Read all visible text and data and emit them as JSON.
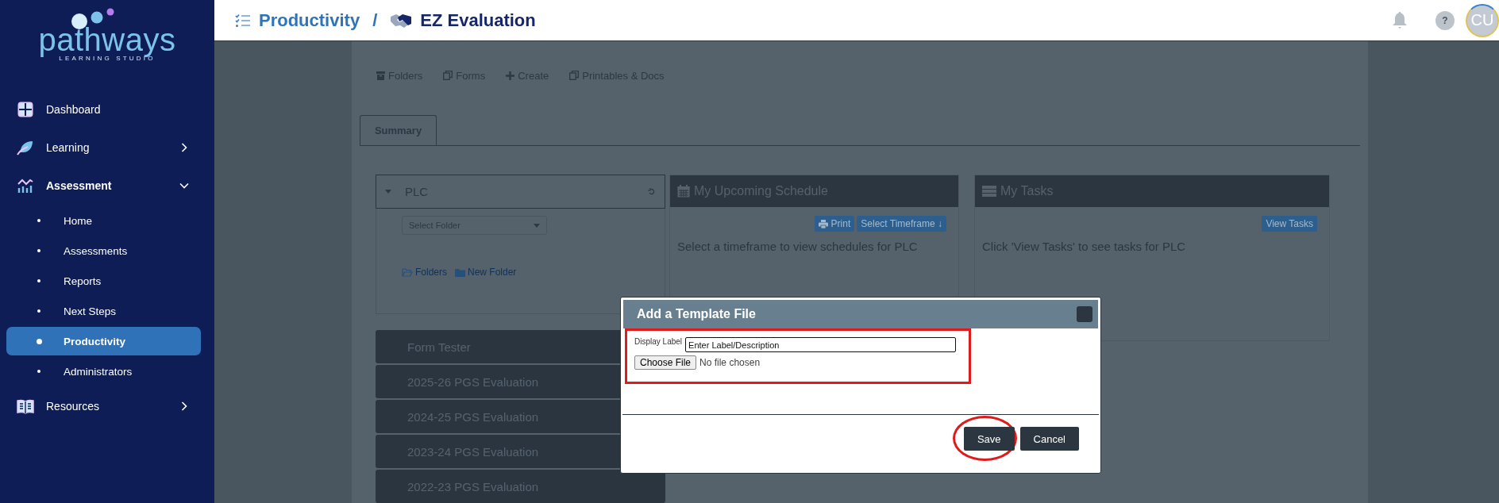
{
  "sidebar": {
    "logo": {
      "wordmark": "pathways",
      "tagline": "LEARNING STUDIO"
    },
    "items": [
      {
        "label": "Dashboard",
        "kind": "link"
      },
      {
        "label": "Learning",
        "kind": "group",
        "expanded": false
      },
      {
        "label": "Assessment",
        "kind": "group",
        "expanded": true,
        "children": [
          {
            "label": "Home",
            "selected": false
          },
          {
            "label": "Assessments",
            "selected": false
          },
          {
            "label": "Reports",
            "selected": false
          },
          {
            "label": "Next Steps",
            "selected": false
          },
          {
            "label": "Productivity",
            "selected": true
          },
          {
            "label": "Administrators",
            "selected": false
          }
        ]
      },
      {
        "label": "Resources",
        "kind": "group",
        "expanded": false
      }
    ]
  },
  "header": {
    "breadcrumb": [
      {
        "label": "Productivity",
        "kind": "section"
      },
      {
        "label": "EZ Evaluation",
        "kind": "page"
      }
    ],
    "separator": "/",
    "help": "?",
    "avatar": "CU"
  },
  "toolbar": [
    "Folders",
    "Forms",
    "Create",
    "Printables & Docs"
  ],
  "tabs": [
    {
      "label": "Summary",
      "selected": true
    }
  ],
  "folder_panel": {
    "title": "PLC",
    "select_placeholder": "Select Folder",
    "links": [
      "Folders",
      "New Folder"
    ]
  },
  "schedule_panel": {
    "title": "My Upcoming Schedule",
    "buttons": [
      {
        "label": "Print"
      },
      {
        "label": "Select Timeframe ↓"
      }
    ],
    "message": "Select a timeframe to view schedules for PLC"
  },
  "tasks_panel": {
    "title": "My Tasks",
    "buttons": [
      {
        "label": "View Tasks"
      }
    ],
    "message": "Click 'View Tasks' to see tasks for PLC"
  },
  "forms": [
    "Form Tester",
    "2025-26 PGS Evaluation",
    "2024-25 PGS Evaluation",
    "2023-24 PGS Evaluation",
    "2022-23 PGS Evaluation"
  ],
  "modal": {
    "title": "Add a Template File",
    "field_label": "Display Label",
    "placeholder": "Enter Label/Description",
    "file_button": "Choose File",
    "file_status": "No file chosen",
    "buttons": [
      {
        "label": "Save",
        "kind": "primary"
      },
      {
        "label": "Cancel",
        "kind": "secondary"
      }
    ]
  }
}
